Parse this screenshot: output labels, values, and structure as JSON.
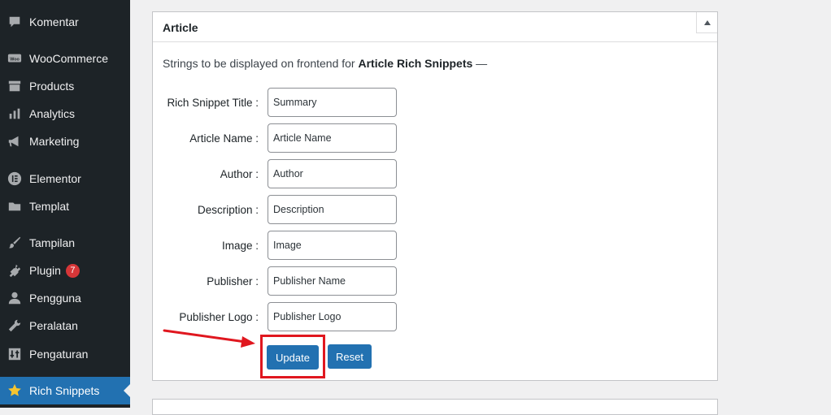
{
  "sidebar": {
    "items": [
      {
        "label": "Komentar",
        "icon": "comment-icon"
      },
      {
        "label": "WooCommerce",
        "icon": "woocommerce-icon"
      },
      {
        "label": "Products",
        "icon": "archive-icon"
      },
      {
        "label": "Analytics",
        "icon": "bar-chart-icon"
      },
      {
        "label": "Marketing",
        "icon": "megaphone-icon"
      },
      {
        "label": "Elementor",
        "icon": "elementor-icon"
      },
      {
        "label": "Templat",
        "icon": "folder-icon"
      },
      {
        "label": "Tampilan",
        "icon": "paintbrush-icon"
      },
      {
        "label": "Plugin",
        "icon": "plug-icon",
        "badge": "7"
      },
      {
        "label": "Pengguna",
        "icon": "user-icon"
      },
      {
        "label": "Peralatan",
        "icon": "wrench-icon"
      },
      {
        "label": "Pengaturan",
        "icon": "settings-sliders-icon"
      },
      {
        "label": "Rich Snippets",
        "icon": "star-icon",
        "active": true
      }
    ]
  },
  "panel": {
    "title": "Article",
    "intro_prefix": "Strings to be displayed on frontend for ",
    "intro_bold": "Article Rich Snippets",
    "intro_suffix": " —",
    "fields": [
      {
        "label": "Rich Snippet Title :",
        "value": "Summary"
      },
      {
        "label": "Article Name :",
        "value": "Article Name"
      },
      {
        "label": "Author :",
        "value": "Author"
      },
      {
        "label": "Description :",
        "value": "Description"
      },
      {
        "label": "Image :",
        "value": "Image"
      },
      {
        "label": "Publisher :",
        "value": "Publisher Name"
      },
      {
        "label": "Publisher Logo :",
        "value": "Publisher Logo"
      }
    ],
    "update_label": "Update",
    "reset_label": "Reset"
  },
  "colors": {
    "sidebar_bg": "#1d2327",
    "active_bg": "#2271b1",
    "button_bg": "#2271b1",
    "badge_bg": "#d63638",
    "annotation_red": "#e0171f"
  }
}
